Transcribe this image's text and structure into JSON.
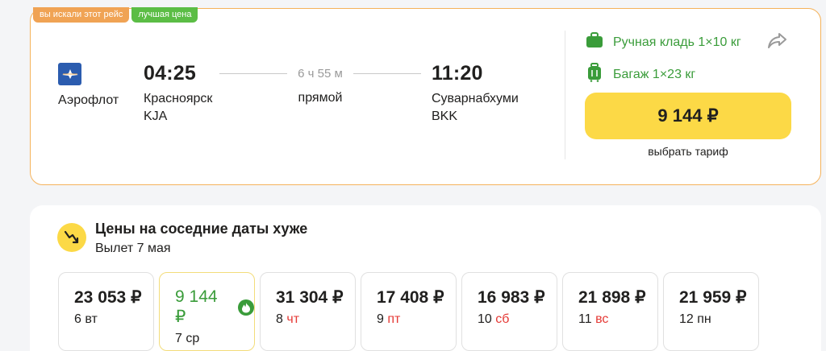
{
  "tags": {
    "searched": "вы искали этот рейс",
    "best_price": "лучшая цена"
  },
  "flight": {
    "airline": "Аэрофлот",
    "departure": {
      "time": "04:25",
      "city": "Красноярск",
      "code": "KJA"
    },
    "arrival": {
      "time": "11:20",
      "city": "Суварнабхуми",
      "code": "BKK"
    },
    "duration": "6 ч 55 м",
    "stops": "прямой"
  },
  "baggage": {
    "hand": "Ручная кладь 1×10 кг",
    "checked": "Багаж 1×23 кг"
  },
  "price_button": "9 144 ₽",
  "tariff_link": "выбрать тариф",
  "nearby": {
    "title": "Цены на соседние даты хуже",
    "subtitle": "Вылет 7 мая",
    "dates": [
      {
        "price": "23 053 ₽",
        "day": "6",
        "weekday": "вт"
      },
      {
        "price": "9 144 ₽",
        "day": "7",
        "weekday": "ср"
      },
      {
        "price": "31 304 ₽",
        "day": "8",
        "weekday": "чт"
      },
      {
        "price": "17 408 ₽",
        "day": "9",
        "weekday": "пт"
      },
      {
        "price": "16 983 ₽",
        "day": "10",
        "weekday": "сб"
      },
      {
        "price": "21 898 ₽",
        "day": "11",
        "weekday": "вс"
      },
      {
        "price": "21 959 ₽",
        "day": "12",
        "weekday": "пн"
      }
    ]
  },
  "colors": {
    "accent_yellow": "#fcd946",
    "green": "#3a9c3a",
    "orange_border": "#f5b25a",
    "weekend_red": "#e53935"
  },
  "icons": [
    "airline-logo",
    "hand-luggage-icon",
    "suitcase-icon",
    "share-icon",
    "trend-down-icon",
    "fire-icon"
  ]
}
